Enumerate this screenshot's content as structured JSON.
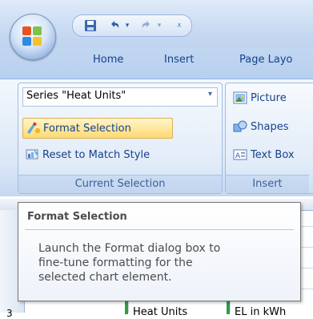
{
  "ribbon": {
    "tabs": [
      "Home",
      "Insert",
      "Page Layo"
    ],
    "current_selection": {
      "dropdown_value": "Series \"Heat Units\"",
      "format_selection_label": "Format Selection",
      "reset_label": "Reset to Match Style",
      "group_label": "Current Selection"
    },
    "insert": {
      "picture_label": "Picture",
      "shapes_label": "Shapes",
      "textbox_label": "Text Box",
      "group_label": "Insert"
    }
  },
  "sheet": {
    "row_number": "3",
    "cells": [
      "Heat Units",
      "EL in kWh"
    ]
  },
  "tooltip": {
    "title": "Format Selection",
    "body_lines": [
      "Launch the Format dialog box to",
      "fine-tune formatting for the",
      "selected chart element."
    ]
  },
  "colors": {
    "ribbon_text": "#15428b",
    "tooltip_text": "#4c4c4c",
    "highlight": "#ffe08a"
  }
}
